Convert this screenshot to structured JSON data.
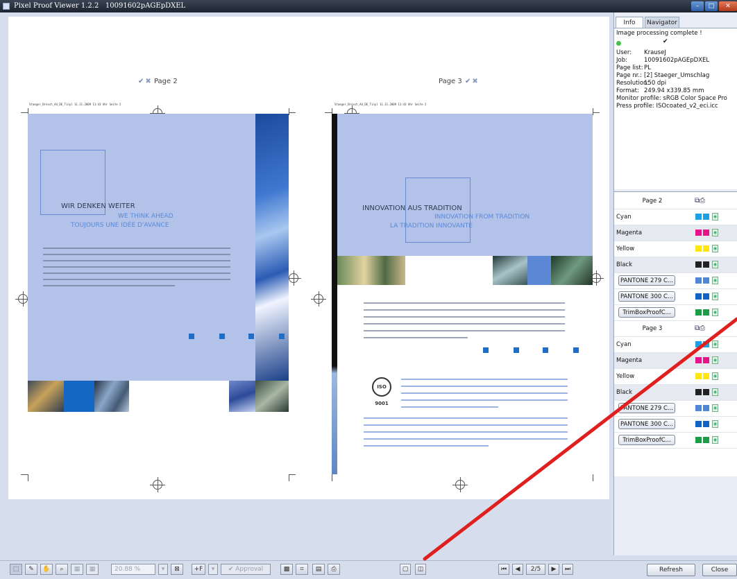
{
  "window": {
    "app_title": "Pixel Proof Viewer 1.2.2",
    "job_title": "10091602pAGEpDXEL"
  },
  "pages": {
    "left_label": "Page 2",
    "right_label": "Page 3",
    "slug_text": "Staeger_Brosch_A4_DE_Tinyl  11.11.2009  11:43 Uhr  Seite  2",
    "left": {
      "heading": "WIR DENKEN WEITER",
      "sub1": "WE THINK AHEAD",
      "sub2": "TOUJOURS UNE IDÉE D'AVANCE"
    },
    "right": {
      "heading": "INNOVATION AUS TRADITION",
      "sub1": "INNOVATION FROM TRADITION",
      "sub2": "LA TRADITION INNOVANTE",
      "cert": "ISO 9001"
    }
  },
  "panel": {
    "tabs": [
      "Info",
      "Navigator"
    ],
    "status": "Image processing complete !",
    "info_rows": [
      {
        "key": "User:",
        "value": "KrauseJ"
      },
      {
        "key": "Job:",
        "value": "10091602pAGEpDXEL"
      },
      {
        "key": "Page list:",
        "value": "PL"
      },
      {
        "key": "Page nr.:",
        "value": "[2] Staeger_Umschlag"
      },
      {
        "key": "Resolution:",
        "value": "150 dpi"
      },
      {
        "key": "Format:",
        "value": "249.94 x339.85 mm"
      }
    ],
    "monitor_profile": "Monitor profile: sRGB Color Space Pro",
    "press_profile": "Press profile:  ISOcoated_v2_eci.icc",
    "separations": [
      {
        "label": "Page 2",
        "kind": "header"
      },
      {
        "label": "Cyan",
        "kind": "plain",
        "c1": "#1ea0e6",
        "c2": "#1ea0e6"
      },
      {
        "label": "Magenta",
        "kind": "plain",
        "c1": "#e8158a",
        "c2": "#e8158a"
      },
      {
        "label": "Yellow",
        "kind": "plain",
        "c1": "#ffe514",
        "c2": "#ffe514"
      },
      {
        "label": "Black",
        "kind": "plain",
        "c1": "#222222",
        "c2": "#222222"
      },
      {
        "label": "PANTONE 279 C...",
        "kind": "pill",
        "c1": "#4f86d8",
        "c2": "#4f86d8"
      },
      {
        "label": "PANTONE 300 C...",
        "kind": "pill",
        "c1": "#0f63c2",
        "c2": "#0f63c2"
      },
      {
        "label": "TrimBoxProofC...",
        "kind": "pill",
        "c1": "#1a9e45",
        "c2": "#1a9e45"
      },
      {
        "label": "Page 3",
        "kind": "header"
      },
      {
        "label": "Cyan",
        "kind": "plain",
        "c1": "#1ea0e6",
        "c2": "#1ea0e6"
      },
      {
        "label": "Magenta",
        "kind": "plain",
        "c1": "#e8158a",
        "c2": "#e8158a"
      },
      {
        "label": "Yellow",
        "kind": "plain",
        "c1": "#ffe514",
        "c2": "#ffe514"
      },
      {
        "label": "Black",
        "kind": "plain",
        "c1": "#222222",
        "c2": "#222222"
      },
      {
        "label": "PANTONE 279 C...",
        "kind": "pill",
        "c1": "#4f86d8",
        "c2": "#4f86d8"
      },
      {
        "label": "PANTONE 300 C...",
        "kind": "pill",
        "c1": "#0f63c2",
        "c2": "#0f63c2"
      },
      {
        "label": "TrimBoxProofC...",
        "kind": "pill",
        "c1": "#1a9e45",
        "c2": "#1a9e45"
      }
    ]
  },
  "toolbar": {
    "zoom_value": "20.88 %",
    "approval_label": "✔ Approval",
    "page_counter": "2/5",
    "refresh_label": "Refresh",
    "close_label": "Close"
  },
  "colors": {
    "page_blue": "#b3c2e8",
    "accent_blue": "#1e6ec8",
    "annotation_red": "#e01f1f"
  }
}
